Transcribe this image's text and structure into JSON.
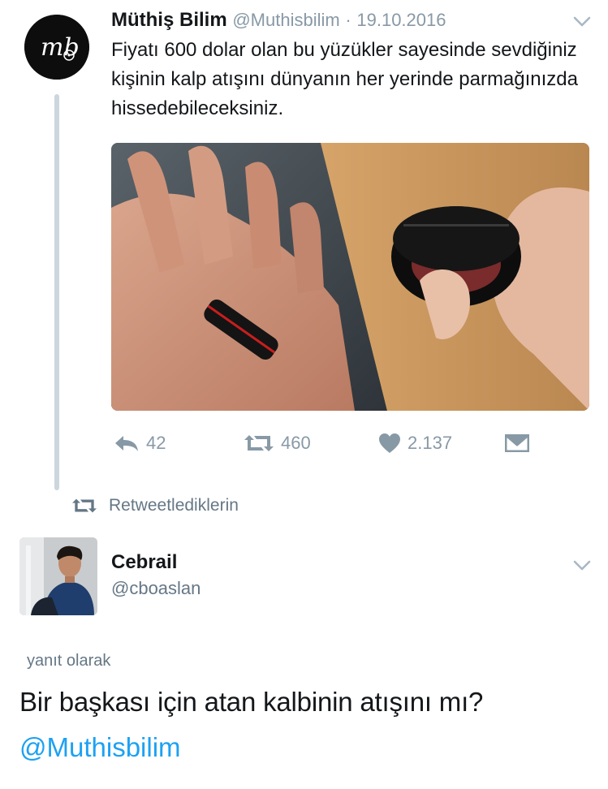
{
  "tweet": {
    "author_name": "Müthiş Bilim",
    "author_handle": "@Muthisbilim",
    "separator": "·",
    "date": "19.10.2016",
    "avatar_text": "mb",
    "text": "Fiyatı 600 dolar olan bu yüzükler sayesinde sevdiğiniz kişinin kalp atışını dünyanın her yerinde parmağınızda hissedebileceksiniz.",
    "media_icon": "photo-ring-on-palm",
    "actions": {
      "reply_icon": "reply-icon",
      "reply_count": "42",
      "retweet_icon": "retweet-icon",
      "retweet_count": "460",
      "like_icon": "heart-icon",
      "like_count": "2.137",
      "dm_icon": "envelope-icon"
    }
  },
  "retweeted_label": "Retweetlediklerin",
  "reply": {
    "author_name": "Cebrail",
    "author_handle": "@cboaslan",
    "reply_to_label": "yanıt olarak",
    "text": "Bir başkası için atan kalbinin atışını mı?",
    "mention": "@Muthisbilim"
  },
  "colors": {
    "text": "#14171a",
    "secondary": "#8899a6",
    "link": "#1da1f2",
    "thread_line": "#ccd6dd"
  }
}
